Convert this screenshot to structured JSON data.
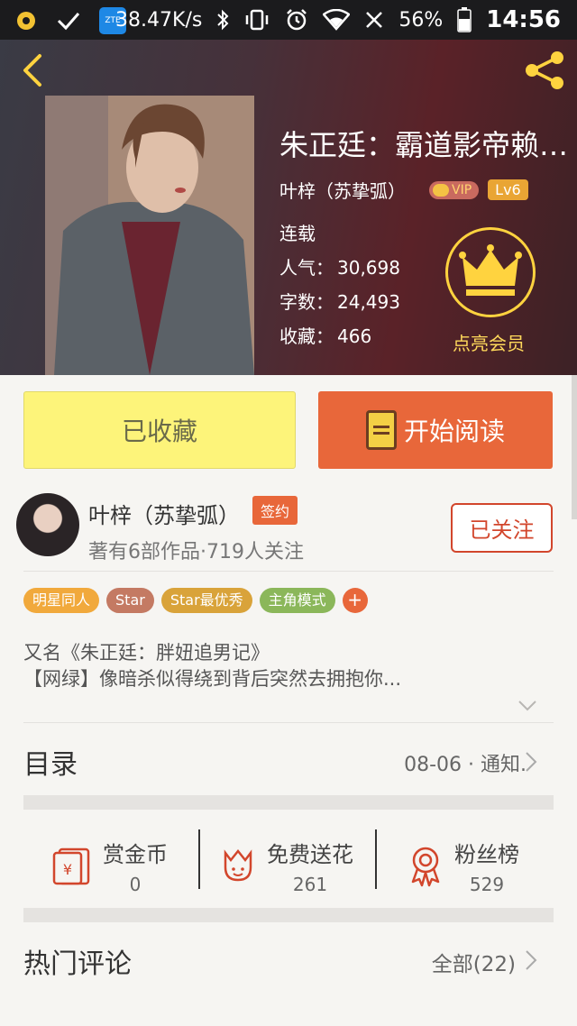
{
  "status_bar": {
    "network_speed": "38.47K/s",
    "battery": "56%",
    "time": "14:56",
    "app_icon_text": "ZTE"
  },
  "book": {
    "title": "朱正廷：霸道影帝赖…",
    "author": "叶梓（苏挚弧）",
    "vip_label": "VIP",
    "level": "Lv6",
    "status": "连载",
    "popularity_label": "人气：",
    "popularity": "30,698",
    "word_count_label": "字数：",
    "word_count": "24,493",
    "favorites_label": "收藏：",
    "favorites": "466",
    "member_label": "点亮会员"
  },
  "actions": {
    "favorited_label": "已收藏",
    "read_label": "开始阅读"
  },
  "author_info": {
    "name": "叶梓（苏挚弧）",
    "signed_label": "签约",
    "meta": "著有6部作品·719人关注",
    "follow_label": "已关注"
  },
  "tags": [
    {
      "label": "明星同人",
      "color": "#f1a93c"
    },
    {
      "label": "Star",
      "color": "#c47a63"
    },
    {
      "label": "Star最优秀",
      "color": "#d9a33a"
    },
    {
      "label": "主角模式",
      "color": "#8bb75a"
    }
  ],
  "tag_add": "+",
  "intro": {
    "line1": "又名《朱正廷：胖妞追男记》",
    "line2": "【网绿】像暗杀似得绕到背后突然去拥抱你..."
  },
  "catalog": {
    "title": "目录",
    "latest": "08-06 · 通知."
  },
  "stats": [
    {
      "label": "赏金币",
      "value": "0"
    },
    {
      "label": "免费送花",
      "value": "261"
    },
    {
      "label": "粉丝榜",
      "value": "529"
    }
  ],
  "comments": {
    "title": "热门评论",
    "all_label": "全部(22)"
  },
  "colors": {
    "accent": "#e8673a",
    "favorite_bg": "#fdf47a",
    "member_gold": "#ffd33f",
    "follow_red": "#d2462c"
  }
}
